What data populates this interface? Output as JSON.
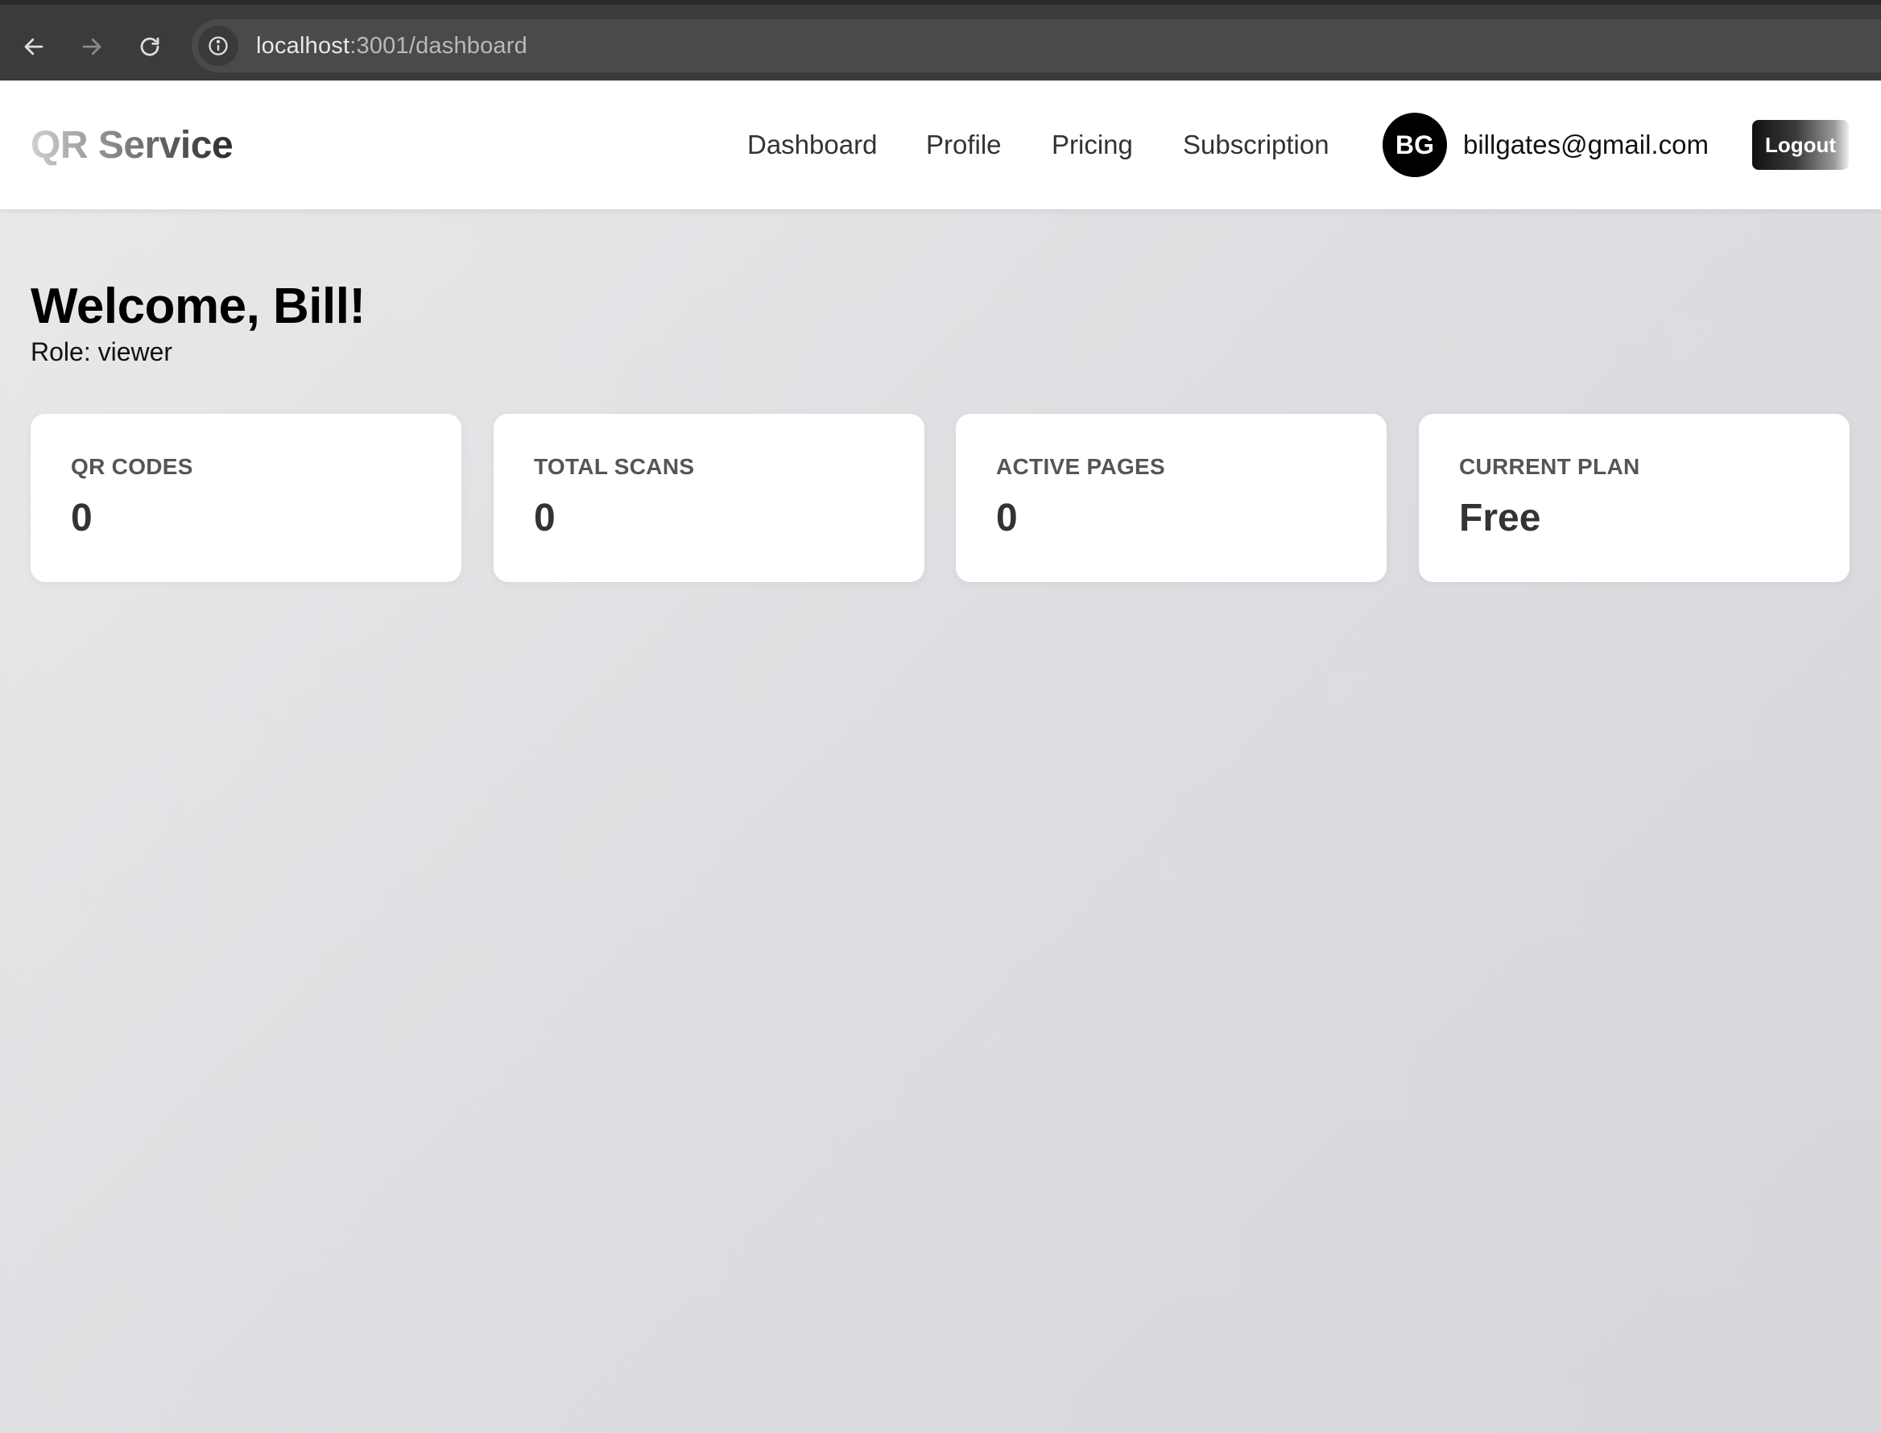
{
  "browser": {
    "url_host": "localhost",
    "url_path": ":3001/dashboard"
  },
  "header": {
    "brand": "QR Service",
    "nav": [
      "Dashboard",
      "Profile",
      "Pricing",
      "Subscription"
    ],
    "avatar_initials": "BG",
    "user_email": "billgates@gmail.com",
    "logout_label": "Logout"
  },
  "main": {
    "welcome": "Welcome, Bill!",
    "role": "Role: viewer",
    "stats": [
      {
        "label": "QR CODES",
        "value": "0"
      },
      {
        "label": "TOTAL SCANS",
        "value": "0"
      },
      {
        "label": "ACTIVE PAGES",
        "value": "0"
      },
      {
        "label": "CURRENT PLAN",
        "value": "Free"
      }
    ]
  },
  "colors": {
    "browser_bar": "#3b3b3b",
    "avatar_bg": "#000000",
    "header_bg": "#ffffff"
  },
  "icons": [
    "back-arrow-icon",
    "forward-arrow-icon",
    "reload-icon",
    "info-icon"
  ]
}
